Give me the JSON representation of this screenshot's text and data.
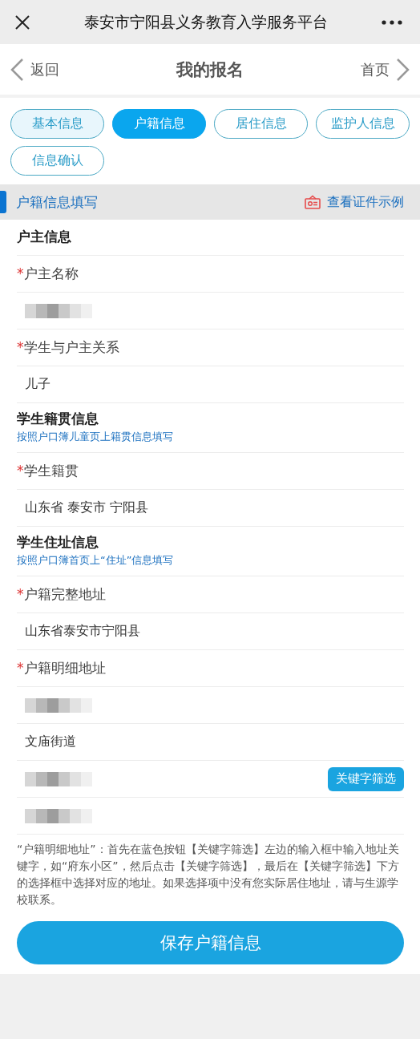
{
  "window": {
    "title": "泰安市宁阳县义务教育入学服务平台"
  },
  "nav": {
    "back": "返回",
    "title": "我的报名",
    "home": "首页"
  },
  "tabs": [
    {
      "label": "基本信息",
      "selected": false,
      "visited": true
    },
    {
      "label": "户籍信息",
      "selected": true
    },
    {
      "label": "居住信息",
      "selected": false
    },
    {
      "label": "监护人信息",
      "selected": false
    },
    {
      "label": "信息确认",
      "selected": false
    }
  ],
  "section": {
    "title": "户籍信息填写",
    "link": "查看证件示例"
  },
  "rows": [
    {
      "kind": "heading",
      "text": "户主信息"
    },
    {
      "kind": "label",
      "asterisk": "*",
      "text": "户主名称"
    },
    {
      "kind": "blurred"
    },
    {
      "kind": "label",
      "asterisk": "*",
      "text": "学生与户主关系"
    },
    {
      "kind": "value",
      "text": "儿子"
    },
    {
      "kind": "heading",
      "text": "学生籍贯信息",
      "hint": "按照户口簿儿童页上籍贯信息填写"
    },
    {
      "kind": "label",
      "asterisk": "*",
      "text": "学生籍贯"
    },
    {
      "kind": "value",
      "text": "山东省 泰安市 宁阳县"
    },
    {
      "kind": "heading",
      "text": "学生住址信息",
      "hint": "按照户口簿首页上“住址”信息填写"
    },
    {
      "kind": "label",
      "asterisk": "*",
      "text": "户籍完整地址"
    },
    {
      "kind": "value",
      "text": "山东省泰安市宁阳县"
    },
    {
      "kind": "label",
      "asterisk": "*",
      "text": "户籍明细地址"
    },
    {
      "kind": "blurred"
    },
    {
      "kind": "value",
      "text": "文庙街道"
    },
    {
      "kind": "blurred",
      "button": "关键字筛选"
    },
    {
      "kind": "blurred"
    }
  ],
  "note": "“户籍明细地址”：首先在蓝色按钮【关键字筛选】左边的输入框中输入地址关键字，如“府东小区”，然后点击【关键字筛选】，最后在【关键字筛选】下方的选择框中选择对应的地址。如果选择项中没有您实际居住地址，请与生源学校联系。",
  "save_button": "保存户籍信息"
}
